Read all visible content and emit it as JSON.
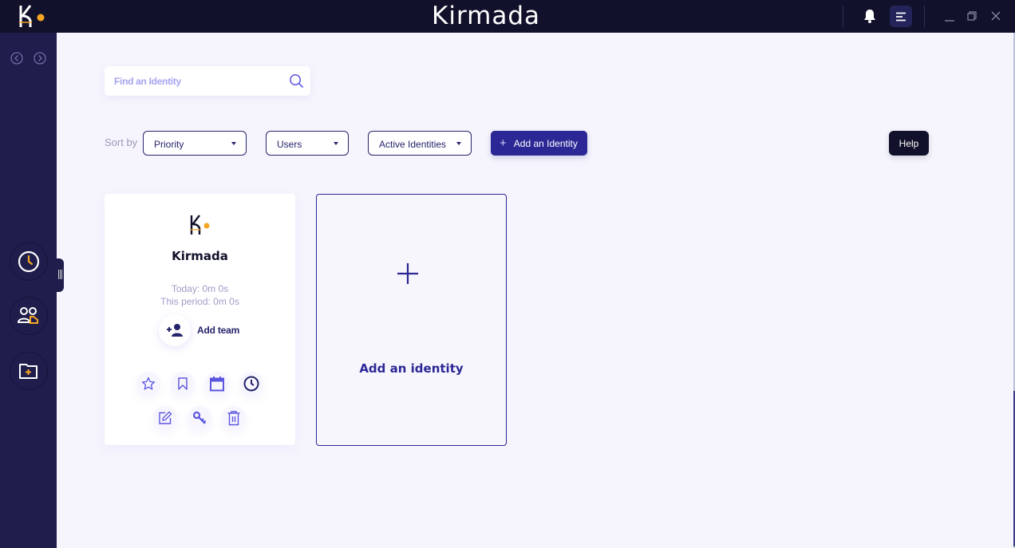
{
  "titlebar": {
    "brand": "Kirmada",
    "icons": {
      "logo": "kirmada-logo",
      "notifications": "bell-icon",
      "menu": "menu-icon",
      "minimize": "minimize-icon",
      "restore": "restore-icon",
      "close": "close-icon"
    }
  },
  "sidebar": {
    "nav": {
      "back": "chevron-left-icon",
      "forward": "chevron-right-icon"
    },
    "items": [
      {
        "name": "time-tracking",
        "icon": "clock-icon"
      },
      {
        "name": "teams",
        "icon": "users-icon"
      },
      {
        "name": "add-folder",
        "icon": "folder-plus-icon"
      }
    ]
  },
  "search": {
    "placeholder": "Find an Identity",
    "value": ""
  },
  "toolbar": {
    "sort_label": "Sort by",
    "sort_value": "Priority",
    "users_value": "Users",
    "status_value": "Active Identities",
    "add_label": "Add an Identity",
    "help_label": "Help"
  },
  "identities": [
    {
      "name": "Kirmada",
      "today": "Today: 0m 0s",
      "period": "This period: 0m 0s",
      "add_team_label": "Add team",
      "actions": [
        "star-icon",
        "bookmark-icon",
        "calendar-icon",
        "clock-icon",
        "edit-icon",
        "key-icon",
        "trash-icon"
      ]
    }
  ],
  "add_card": {
    "label": "Add an identity"
  },
  "colors": {
    "primary": "#2b2795",
    "dark": "#11112b",
    "sidebar": "#1f1d4b",
    "accent": "#f6a623",
    "background": "#f6f5fd"
  }
}
